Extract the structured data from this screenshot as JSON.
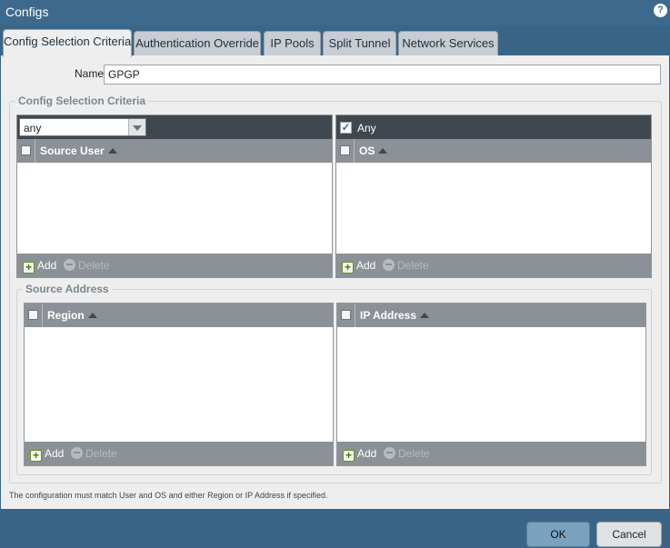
{
  "window": {
    "title": "Configs",
    "help_glyph": "?"
  },
  "tabs": [
    {
      "label": "Config Selection Criteria",
      "active": true
    },
    {
      "label": "Authentication Override"
    },
    {
      "label": "IP Pools"
    },
    {
      "label": "Split Tunnel"
    },
    {
      "label": "Network Services"
    }
  ],
  "form": {
    "name_label": "Name",
    "name_value": "GPGP"
  },
  "criteria": {
    "legend": "Config Selection Criteria",
    "user_select": "any",
    "user_column": "Source User",
    "os_any_label": "Any",
    "os_any_checked": true,
    "os_column": "OS"
  },
  "source_address": {
    "legend": "Source Address",
    "region_column": "Region",
    "ip_column": "IP Address"
  },
  "actions": {
    "add": "Add",
    "delete": "Delete"
  },
  "note": "The configuration must match User and OS and either Region or IP Address if specified.",
  "footer": {
    "ok": "OK",
    "cancel": "Cancel"
  },
  "colors": {
    "titlebar": "#3d6a8c",
    "panel_header": "#8b9196",
    "panel_dark": "#3f474f",
    "ok_button": "#7aa1bd"
  }
}
